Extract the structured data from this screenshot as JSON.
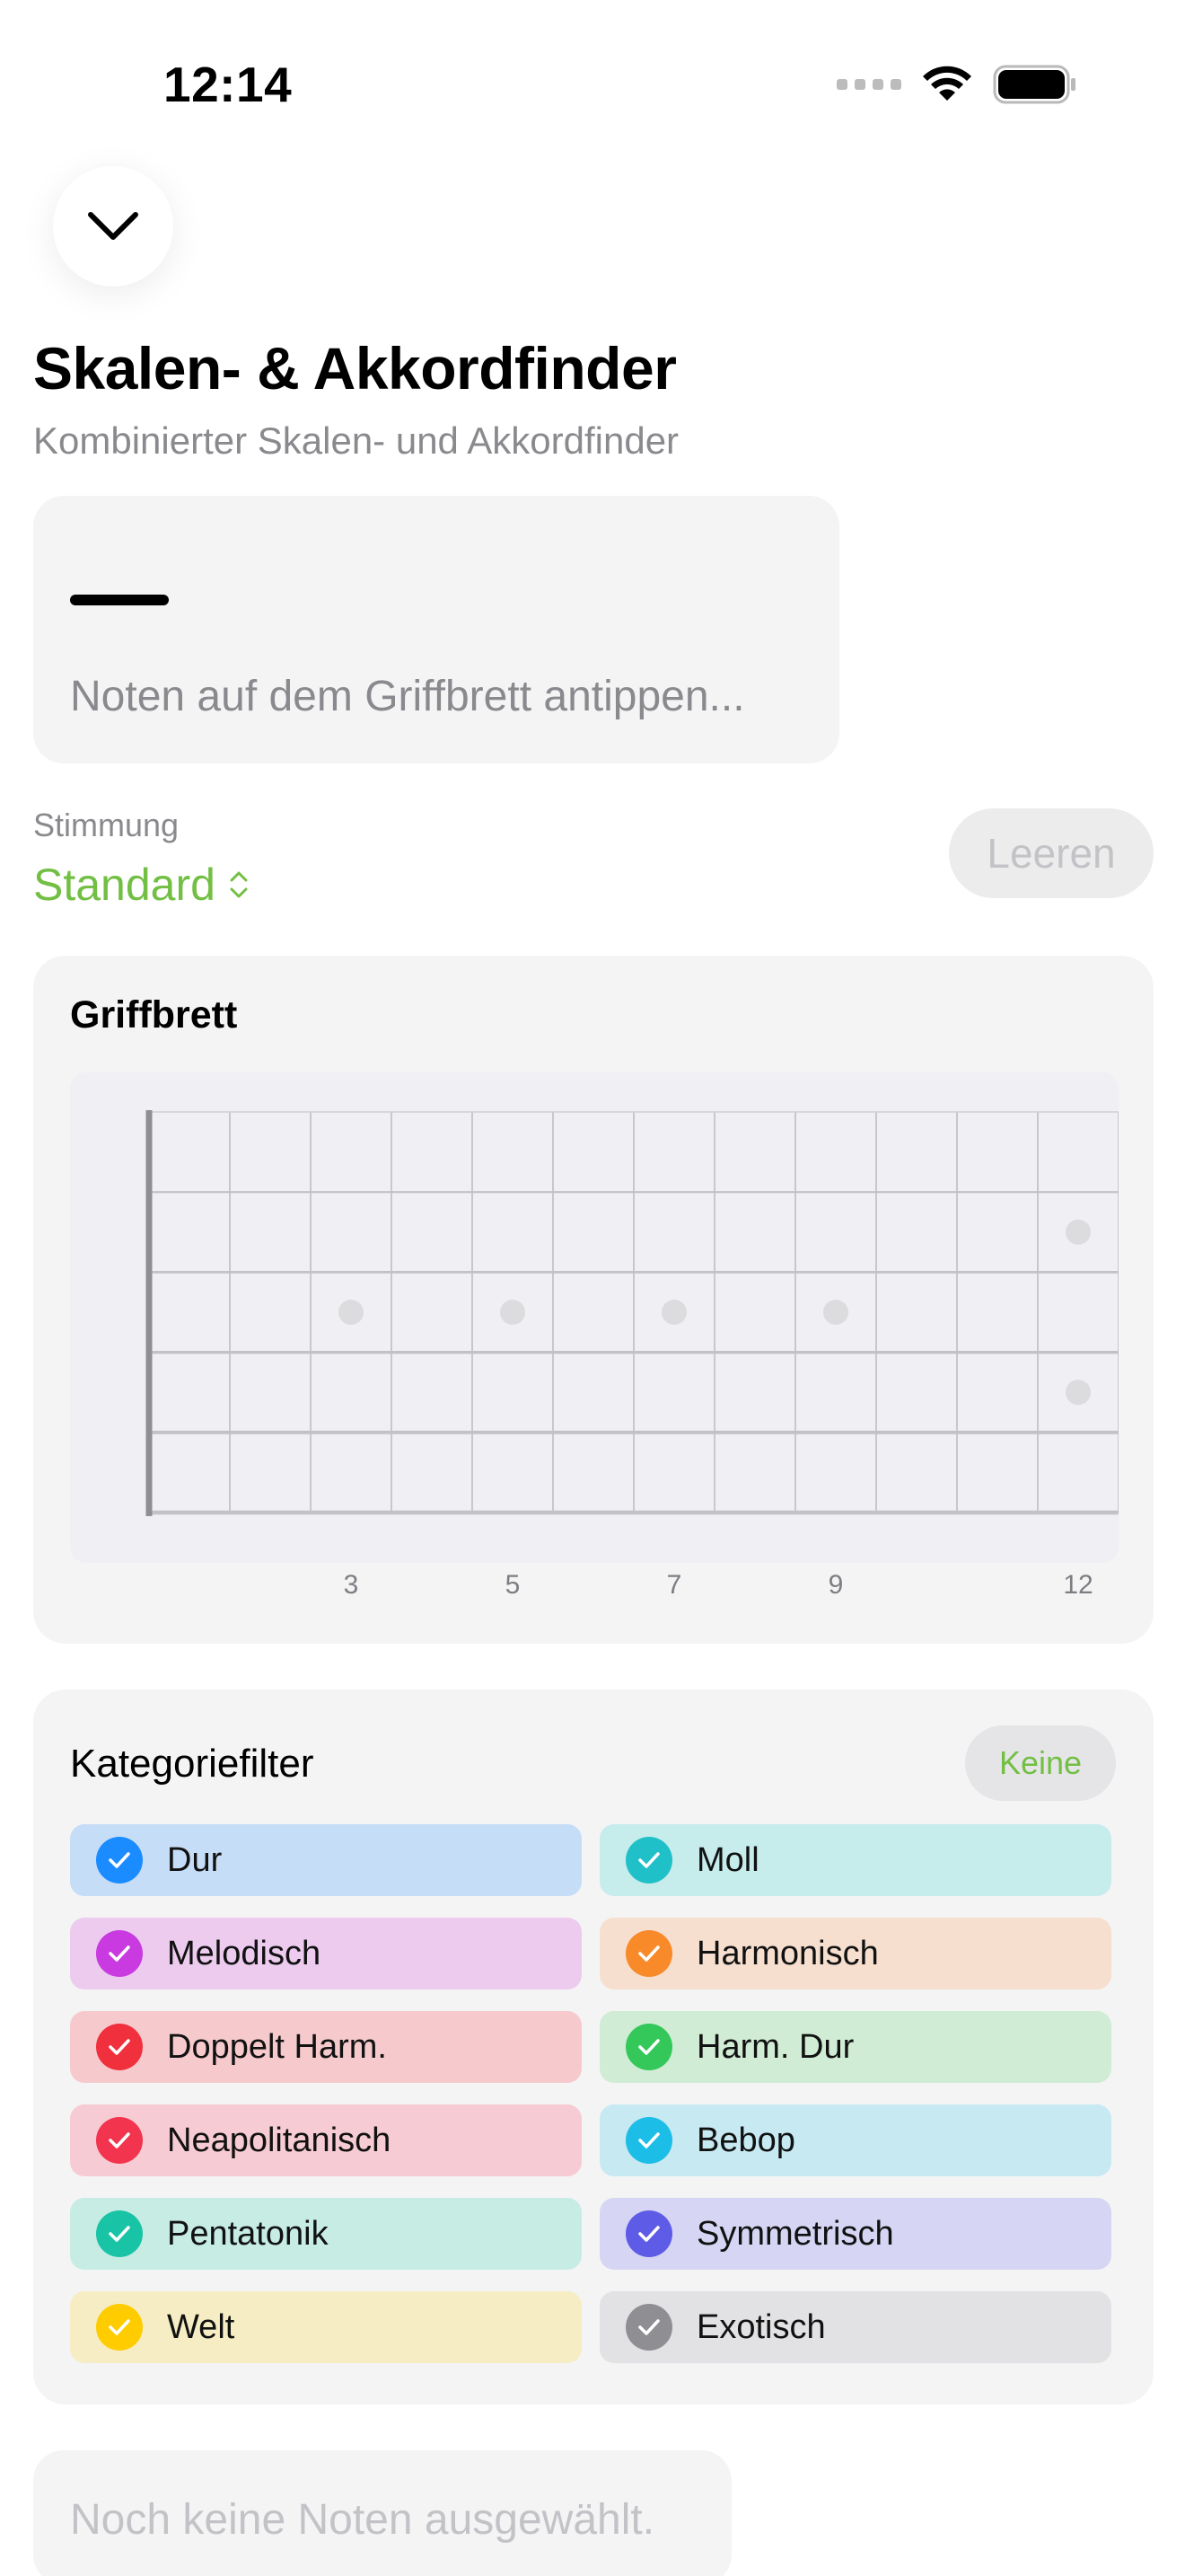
{
  "status": {
    "time": "12:14"
  },
  "header": {
    "title": "Skalen- & Akkordfinder",
    "subtitle": "Kombinierter Skalen- und Akkordfinder"
  },
  "notes": {
    "hint": "Noten auf dem Griffbrett antippen..."
  },
  "tuning": {
    "label": "Stimmung",
    "value": "Standard",
    "clear_label": "Leeren"
  },
  "fretboard": {
    "title": "Griffbrett",
    "fret_numbers": [
      "3",
      "5",
      "7",
      "9",
      "12"
    ]
  },
  "category_filter": {
    "title": "Kategoriefilter",
    "none_label": "Keine",
    "categories": [
      {
        "label": "Dur",
        "bg": "#c6ddf7",
        "color": "#1a8cff"
      },
      {
        "label": "Moll",
        "bg": "#c7ecec",
        "color": "#1fc0c8"
      },
      {
        "label": "Melodisch",
        "bg": "#eccbef",
        "color": "#c93ae0"
      },
      {
        "label": "Harmonisch",
        "bg": "#f6dfcf",
        "color": "#f88a2a"
      },
      {
        "label": "Doppelt Harm.",
        "bg": "#f6cacd",
        "color": "#f0303c"
      },
      {
        "label": "Harm. Dur",
        "bg": "#d0ecd5",
        "color": "#34c759"
      },
      {
        "label": "Neapolitanisch",
        "bg": "#f6cbd3",
        "color": "#f2344e"
      },
      {
        "label": "Bebop",
        "bg": "#c6e9f2",
        "color": "#1cbde6"
      },
      {
        "label": "Pentatonik",
        "bg": "#c6ece4",
        "color": "#19c4a6"
      },
      {
        "label": "Symmetrisch",
        "bg": "#d6d5f4",
        "color": "#5e5ce6"
      },
      {
        "label": "Welt",
        "bg": "#f6edc4",
        "color": "#ffcc00"
      },
      {
        "label": "Exotisch",
        "bg": "#e2e2e4",
        "color": "#8e8e93"
      }
    ]
  },
  "empty_state": {
    "text": "Noch keine Noten ausgewählt."
  }
}
